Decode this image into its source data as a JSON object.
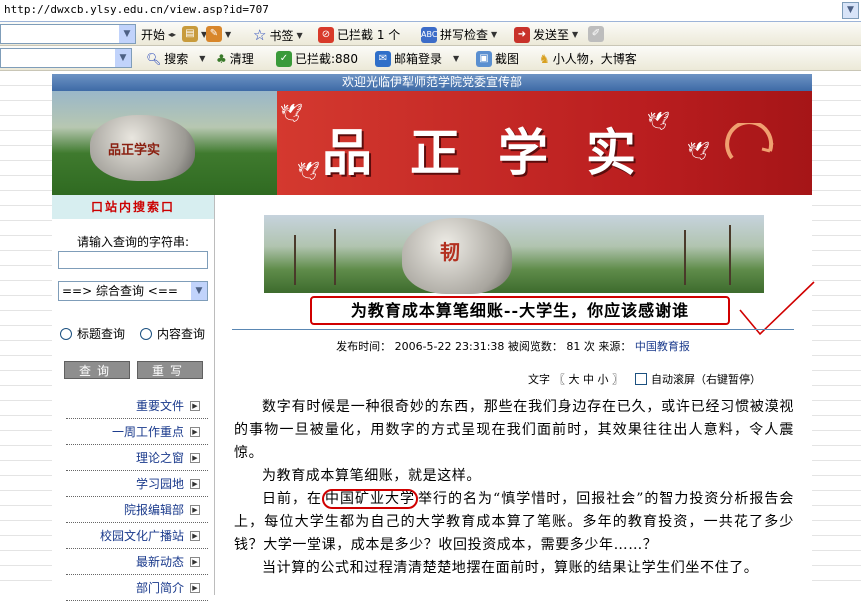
{
  "browser": {
    "url": "http://dwxcb.ylsy.edu.cn/view.asp?id=707",
    "toolbar1": {
      "start": "开始",
      "bookmarks": "书签",
      "blocked": "已拦截 1 个",
      "spellcheck": "拼写检查",
      "sendto": "发送至"
    },
    "toolbar2": {
      "search": "搜索",
      "clear": "清理",
      "blocked": "已拦截:880",
      "mail": "邮箱登录",
      "screenshot": "截图",
      "blog": "小人物，大博客"
    }
  },
  "site": {
    "welcome": "欢迎光临伊犁师范学院党委宣传部",
    "banner_title": "品正学实",
    "rock_text": "品正学实"
  },
  "sidebar": {
    "heading": "口站内搜索口",
    "prompt": "请输入查询的字符串:",
    "search_value": "",
    "select_value": "==> 综合查询 <==",
    "radio_title": "标题查询",
    "radio_content": "内容查询",
    "query_button": "查询",
    "reset_button": "重写",
    "links": [
      {
        "label": "重要文件"
      },
      {
        "label": "一周工作重点"
      },
      {
        "label": "理论之窗"
      },
      {
        "label": "学习园地"
      },
      {
        "label": "院报编辑部"
      },
      {
        "label": "校园文化广播站"
      },
      {
        "label": "最新动态"
      },
      {
        "label": "部门简介"
      }
    ]
  },
  "article": {
    "photo_rock_text": "韧",
    "title": "为教育成本算笔细账--大学生，你应该感谢谁",
    "meta_label_time": "发布时间：",
    "meta_time": "2006-5-22 23:31:38",
    "meta_label_views": "被阅览数：",
    "meta_views": "81",
    "meta_views_unit": "次",
    "meta_label_source": "来源：",
    "meta_source": "中国教育报",
    "font_label": "文字",
    "font_sizes": "〖 大 中 小 〗",
    "autoscroll": "自动滚屏（右键暂停）",
    "p1": "数字有时候是一种很奇妙的东西，那些在我们身边存在已久，或许已经习惯被漠视的事物一旦被量化，用数字的方式呈现在我们面前时，其效果往往出人意料，令人震惊。",
    "p2": "为教育成本算笔细账，就是这样。",
    "p3_pre": "日前，在",
    "p3_circled": "中国矿业大学",
    "p3_post": "举行的名为“慎学惜时，回报社会”的智力投资分析报告会上，每位大学生都为自己的大学教育成本算了笔账。多年的教育投资，一共花了多少钱？大学一堂课，成本是多少？收回投资成本，需要多少年……？",
    "p4": "当计算的公式和过程清清楚楚地摆在面前时，算账的结果让学生们坐不住了。"
  }
}
